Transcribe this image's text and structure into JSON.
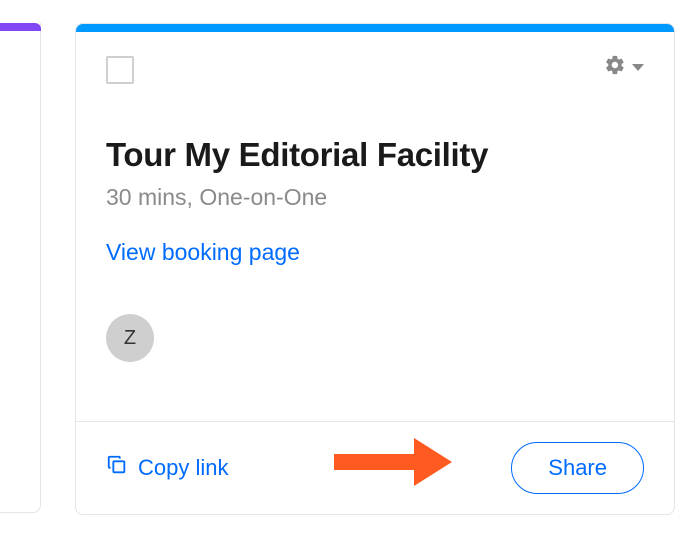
{
  "event": {
    "title": "Tour My Editorial Facility",
    "subtitle": "30 mins, One-on-One",
    "booking_link_label": "View booking page",
    "avatar_initial": "Z"
  },
  "footer": {
    "copy_link_label": "Copy link",
    "share_label": "Share"
  },
  "colors": {
    "card_accent": "#0099ff",
    "prev_card_accent": "#8247f5",
    "link": "#006bff",
    "annotation_arrow": "#ff5a1f"
  }
}
